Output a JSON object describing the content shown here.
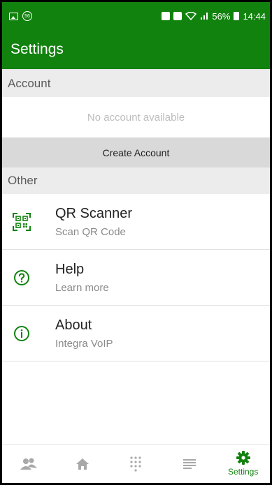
{
  "colors": {
    "primary": "#12820f",
    "icon_gray": "#a8a8a8"
  },
  "status_bar": {
    "left_badge": "56",
    "battery": "56%",
    "time": "14:44"
  },
  "appbar": {
    "title": "Settings"
  },
  "account": {
    "header": "Account",
    "empty_text": "No account available",
    "create_label": "Create Account"
  },
  "other": {
    "header": "Other",
    "items": [
      {
        "icon": "qr-code-icon",
        "title": "QR Scanner",
        "subtitle": "Scan QR Code"
      },
      {
        "icon": "help-circle-icon",
        "title": "Help",
        "subtitle": "Learn more"
      },
      {
        "icon": "info-circle-icon",
        "title": "About",
        "subtitle": "Integra VoIP"
      }
    ]
  },
  "bottom_nav": {
    "items": [
      {
        "icon": "contacts-icon"
      },
      {
        "icon": "home-icon"
      },
      {
        "icon": "dialpad-icon"
      },
      {
        "icon": "list-icon"
      },
      {
        "icon": "gear-icon",
        "label": "Settings",
        "active": true
      }
    ]
  }
}
